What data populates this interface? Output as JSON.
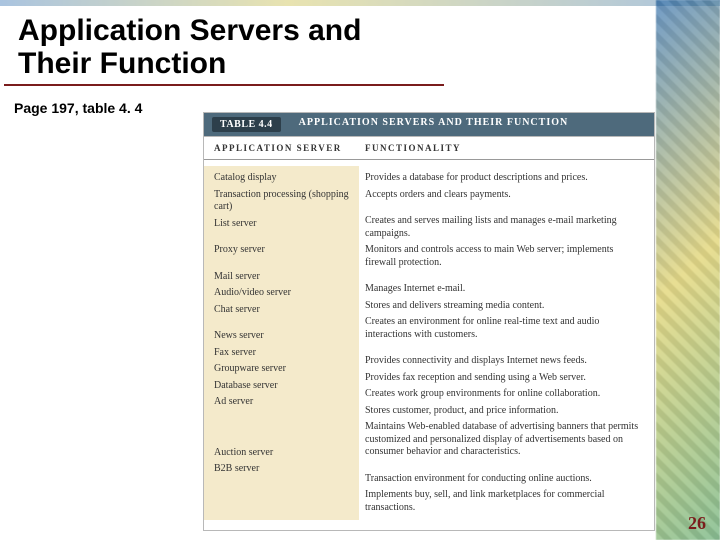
{
  "slide": {
    "title": "Application Servers and Their Function",
    "page_ref": "Page 197, table 4. 4",
    "page_number": "26"
  },
  "table": {
    "tag": "TABLE 4.4",
    "caption": "APPLICATION SERVERS AND THEIR FUNCTION",
    "col_server": "APPLICATION SERVER",
    "col_func": "FUNCTIONALITY",
    "rows": [
      {
        "server": "Catalog display",
        "func": "Provides a database for product descriptions and prices."
      },
      {
        "server": "Transaction processing (shopping cart)",
        "func": "Accepts orders and clears payments."
      },
      {
        "server": "List server",
        "func": "Creates and serves mailing lists and manages e-mail marketing campaigns."
      },
      {
        "server": "Proxy server",
        "func": "Monitors and controls access to main Web server; implements firewall protection."
      },
      {
        "server": "Mail server",
        "func": "Manages Internet e-mail."
      },
      {
        "server": "Audio/video server",
        "func": "Stores and delivers streaming media content."
      },
      {
        "server": "Chat server",
        "func": "Creates an environment for online real-time text and audio interactions with customers."
      },
      {
        "server": "News server",
        "func": "Provides connectivity and displays Internet news feeds."
      },
      {
        "server": "Fax server",
        "func": "Provides fax reception and sending using a Web server."
      },
      {
        "server": "Groupware server",
        "func": "Creates work group environments for online collaboration."
      },
      {
        "server": "Database server",
        "func": "Stores customer, product, and price information."
      },
      {
        "server": "Ad server",
        "func": "Maintains Web-enabled database of advertising banners that permits customized and personalized display of advertisements based on consumer behavior and characteristics."
      },
      {
        "server": "Auction server",
        "func": "Transaction environment for conducting online auctions."
      },
      {
        "server": "B2B server",
        "func": "Implements buy, sell, and link marketplaces for commercial transactions."
      }
    ]
  }
}
